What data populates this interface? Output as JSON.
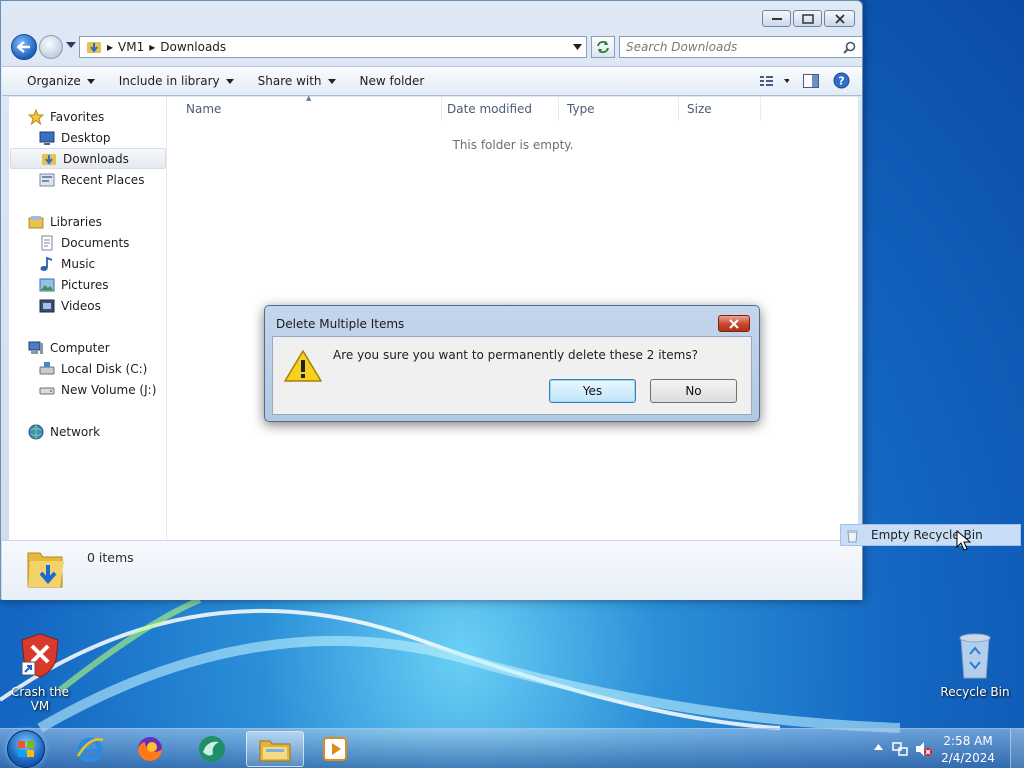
{
  "window": {
    "breadcrumbs": [
      "VM1",
      "Downloads"
    ],
    "search_placeholder": "Search Downloads",
    "toolbar": {
      "organize": "Organize",
      "include_in_library": "Include in library",
      "share_with": "Share with",
      "new_folder": "New folder"
    },
    "nav": {
      "favorites": "Favorites",
      "desktop": "Desktop",
      "downloads": "Downloads",
      "recent_places": "Recent Places",
      "libraries": "Libraries",
      "documents": "Documents",
      "music": "Music",
      "pictures": "Pictures",
      "videos": "Videos",
      "computer": "Computer",
      "local_disk": "Local Disk (C:)",
      "new_volume": "New Volume (J:)",
      "network": "Network"
    },
    "columns": {
      "name": "Name",
      "date_modified": "Date modified",
      "type": "Type",
      "size": "Size"
    },
    "empty_message": "This folder is empty.",
    "details": {
      "item_count": "0 items"
    }
  },
  "dialog": {
    "title": "Delete Multiple Items",
    "message": "Are you sure you want to permanently delete these 2 items?",
    "yes": "Yes",
    "no": "No"
  },
  "context_item": {
    "label": "Empty Recycle Bin"
  },
  "desktop": {
    "crash_vm": "Crash the VM",
    "recycle_bin": "Recycle Bin"
  },
  "taskbar": {
    "time": "2:58 AM",
    "date": "2/4/2024"
  }
}
